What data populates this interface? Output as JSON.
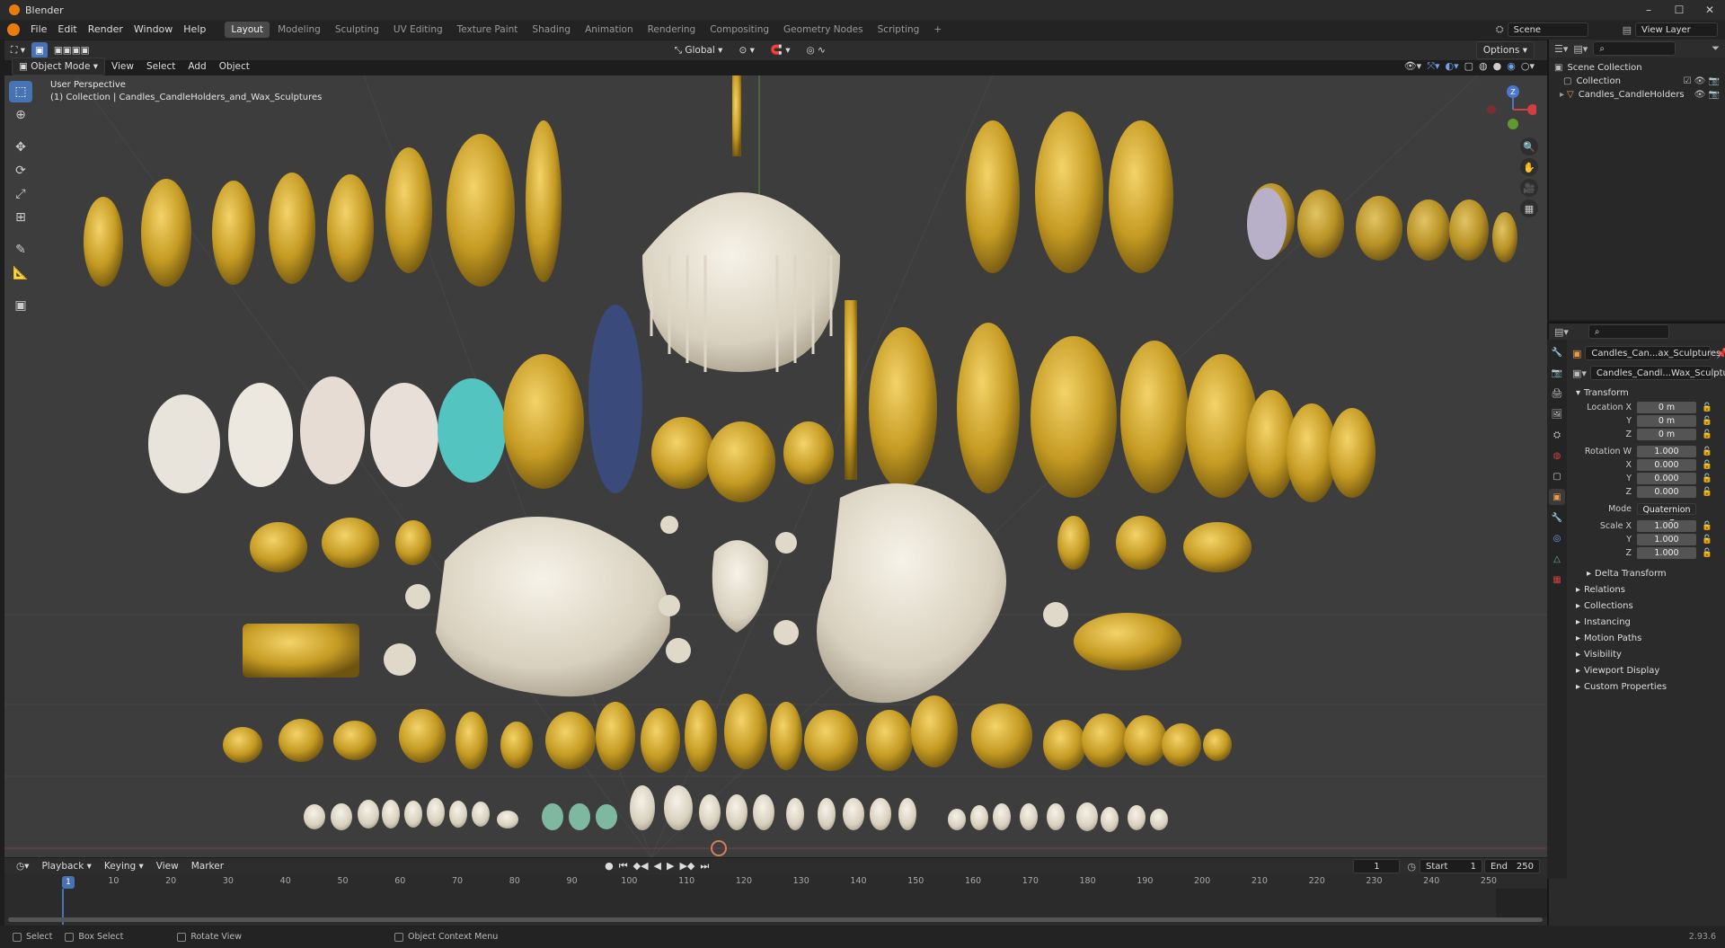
{
  "window": {
    "title": "Blender",
    "controls": [
      "–",
      "☐",
      "✕"
    ]
  },
  "menu": [
    "File",
    "Edit",
    "Render",
    "Window",
    "Help"
  ],
  "workspaces": [
    "Layout",
    "Modeling",
    "Sculpting",
    "UV Editing",
    "Texture Paint",
    "Shading",
    "Animation",
    "Rendering",
    "Compositing",
    "Geometry Nodes",
    "Scripting"
  ],
  "workspace_add": "+",
  "active_workspace": "Layout",
  "scene": {
    "label": "Scene",
    "view_layer": "View Layer"
  },
  "viewport": {
    "mode": "Object Mode",
    "menus": [
      "View",
      "Select",
      "Add",
      "Object"
    ],
    "transform": "Global",
    "options": "Options",
    "info_line1": "User Perspective",
    "info_line2": "(1) Collection | Candles_CandleHolders_and_Wax_Sculptures",
    "gizmo": {
      "z": "Z",
      "x": "X"
    }
  },
  "outliner": {
    "items": [
      {
        "label": "Scene Collection",
        "indent": 0
      },
      {
        "label": "Collection",
        "indent": 1
      },
      {
        "label": "Candles_CandleHolders",
        "indent": 1
      }
    ]
  },
  "properties": {
    "object_name": "Candles_Can...ax_Sculptures",
    "data_name": "Candles_Candl...Wax_Sculptures",
    "transform_header": "Transform",
    "location_label": "Location X",
    "location": [
      "0 m",
      "0 m",
      "0 m"
    ],
    "rotation_label": "Rotation W",
    "rotation": [
      "1.000",
      "0.000",
      "0.000",
      "0.000"
    ],
    "mode_label": "Mode",
    "mode_value": "Quaternion ...",
    "scale_label": "Scale X",
    "scale": [
      "1.000",
      "1.000",
      "1.000"
    ],
    "axis_y": "Y",
    "axis_z": "Z",
    "axis_x": "X",
    "delta_transform": "Delta Transform",
    "panels": [
      "Relations",
      "Collections",
      "Instancing",
      "Motion Paths",
      "Visibility",
      "Viewport Display",
      "Custom Properties"
    ]
  },
  "timeline": {
    "menus": [
      "Playback",
      "Keying",
      "View",
      "Marker"
    ],
    "current_frame": "1",
    "start_label": "Start",
    "start": "1",
    "end_label": "End",
    "end": "250",
    "ticks": [
      "1",
      "10",
      "20",
      "30",
      "40",
      "50",
      "60",
      "70",
      "80",
      "90",
      "100",
      "110",
      "120",
      "130",
      "140",
      "150",
      "160",
      "170",
      "180",
      "190",
      "200",
      "210",
      "220",
      "230",
      "240",
      "250"
    ]
  },
  "statusbar": {
    "select": "Select",
    "box_select": "Box Select",
    "rotate_view": "Rotate View",
    "context_menu": "Object Context Menu",
    "version": "2.93.6"
  },
  "colors": {
    "accent": "#4772b3",
    "gold": "#c9a227",
    "wax": "#e8e2d4",
    "grid": "#444444"
  }
}
